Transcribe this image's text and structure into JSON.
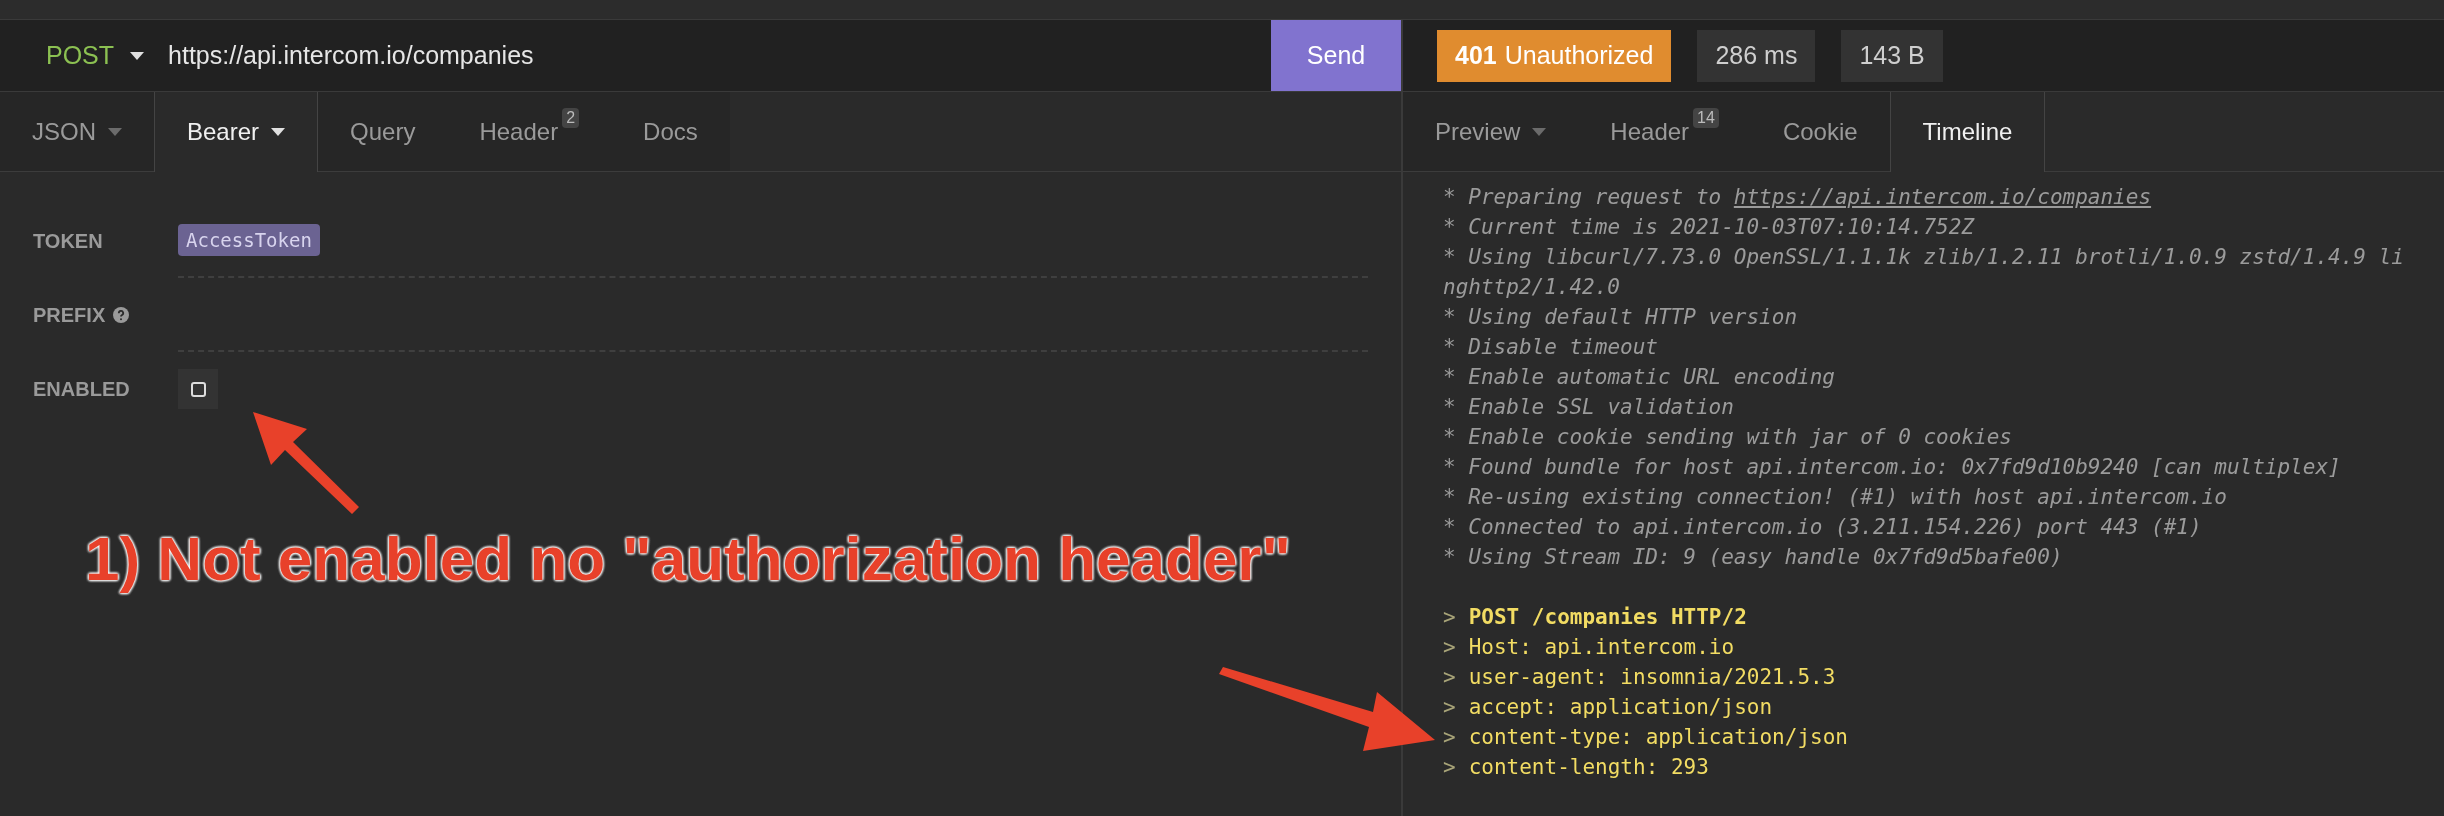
{
  "request": {
    "method": "POST",
    "url": "https://api.intercom.io/companies",
    "send": "Send"
  },
  "request_tabs": [
    {
      "label": "JSON",
      "selected": false,
      "dropdown": true
    },
    {
      "label": "Bearer",
      "selected": true,
      "dropdown": true
    },
    {
      "label": "Query",
      "selected": false,
      "dropdown": false
    },
    {
      "label": "Header",
      "selected": false,
      "dropdown": false,
      "badge": "2"
    },
    {
      "label": "Docs",
      "selected": false,
      "dropdown": false
    }
  ],
  "auth_fields": [
    {
      "label": "TOKEN",
      "kind": "tag",
      "value": "AccessToken"
    },
    {
      "label": "PREFIX",
      "kind": "text",
      "help": true
    },
    {
      "label": "ENABLED",
      "kind": "checkbox",
      "checked": false
    }
  ],
  "response": {
    "status": {
      "code": "401",
      "text": "Unauthorized",
      "color": "#e08c2f"
    },
    "time": "286 ms",
    "size": "143 B"
  },
  "response_tabs": [
    {
      "label": "Preview",
      "selected": false,
      "dropdown": true
    },
    {
      "label": "Header",
      "selected": false,
      "dropdown": false,
      "badge": "14"
    },
    {
      "label": "Cookie",
      "selected": false,
      "dropdown": false
    },
    {
      "label": "Timeline",
      "selected": true,
      "dropdown": false
    }
  ],
  "timeline": [
    {
      "kind": "info",
      "marker": "*",
      "text": "Preparing request to ",
      "link": "https://api.intercom.io/companies"
    },
    {
      "kind": "info",
      "marker": "*",
      "text": "Current time is 2021-10-03T07:10:14.752Z"
    },
    {
      "kind": "info",
      "marker": "*",
      "text": "Using libcurl/7.73.0 OpenSSL/1.1.1k zlib/1.2.11 brotli/1.0.9 zstd/1.4.9 li"
    },
    {
      "kind": "wrap",
      "text": "nghttp2/1.42.0"
    },
    {
      "kind": "info",
      "marker": "*",
      "text": "Using default HTTP version"
    },
    {
      "kind": "info",
      "marker": "*",
      "text": "Disable timeout"
    },
    {
      "kind": "info",
      "marker": "*",
      "text": "Enable automatic URL encoding"
    },
    {
      "kind": "info",
      "marker": "*",
      "text": "Enable SSL validation"
    },
    {
      "kind": "info",
      "marker": "*",
      "text": "Enable cookie sending with jar of 0 cookies"
    },
    {
      "kind": "info",
      "marker": "*",
      "text": "Found bundle for host api.intercom.io: 0x7fd9d10b9240 [can multiplex]"
    },
    {
      "kind": "info",
      "marker": "*",
      "text": "Re-using existing connection! (#1) with host api.intercom.io"
    },
    {
      "kind": "info",
      "marker": "*",
      "text": "Connected to api.intercom.io (3.211.154.226) port 443 (#1)"
    },
    {
      "kind": "info",
      "marker": "*",
      "text": "Using Stream ID: 9 (easy handle 0x7fd9d5bafe00)"
    },
    {
      "kind": "blank"
    },
    {
      "kind": "request_line",
      "marker": ">",
      "text": "POST /companies HTTP/2"
    },
    {
      "kind": "header",
      "marker": ">",
      "text": "Host: api.intercom.io"
    },
    {
      "kind": "header",
      "marker": ">",
      "text": "user-agent: insomnia/2021.5.3"
    },
    {
      "kind": "header",
      "marker": ">",
      "text": "accept: application/json"
    },
    {
      "kind": "header",
      "marker": ">",
      "text": "content-type: application/json"
    },
    {
      "kind": "header",
      "marker": ">",
      "text": "content-length: 293"
    }
  ],
  "annotations": [
    {
      "text": "1) Not enabled no \"authorization header\""
    }
  ]
}
